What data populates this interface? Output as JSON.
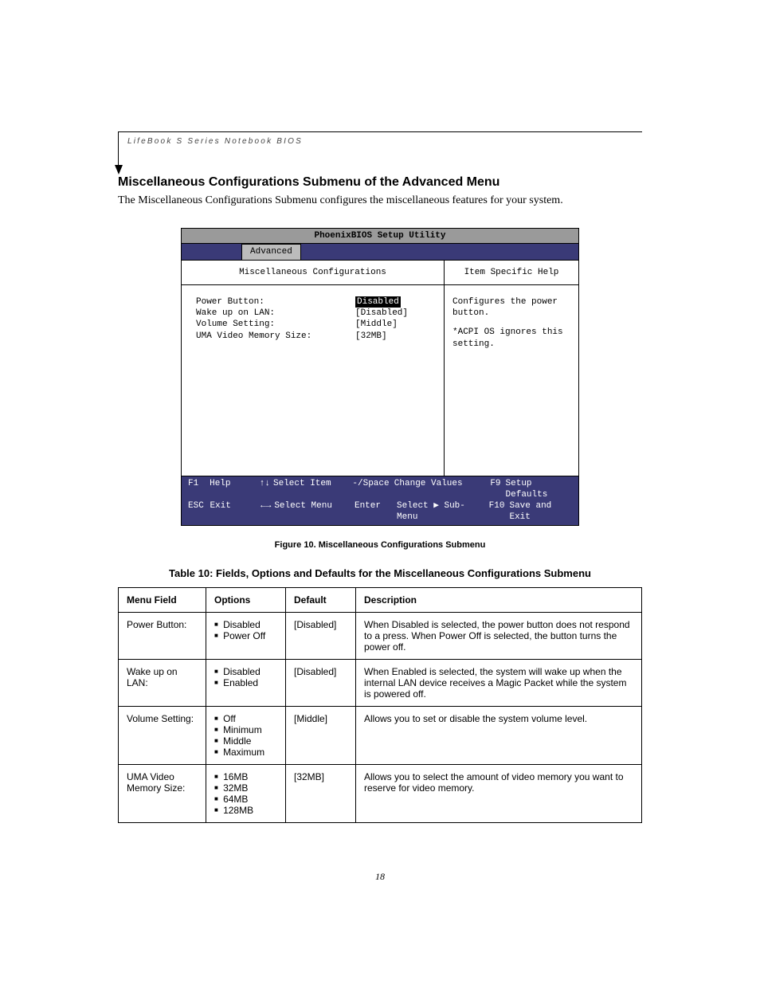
{
  "header": {
    "running_head": "LifeBook S Series Notebook BIOS"
  },
  "section": {
    "title": "Miscellaneous Configurations Submenu of the Advanced Menu",
    "intro": "The Miscellaneous Configurations Submenu configures the miscellaneous features for your system."
  },
  "bios": {
    "utility_title": "PhoenixBIOS Setup Utility",
    "active_tab": "Advanced",
    "submenu_title": "Miscellaneous Configurations",
    "help_title": "Item Specific Help",
    "fields": [
      {
        "label": "Power Button:",
        "value": "Disabled",
        "selected": true
      },
      {
        "label": "Wake up on LAN:",
        "value": "[Disabled]",
        "selected": false
      },
      {
        "label": "Volume Setting:",
        "value": "[Middle]",
        "selected": false
      },
      {
        "label": "UMA Video Memory Size:",
        "value": "[32MB]",
        "selected": false
      }
    ],
    "help_text_1": "Configures the power button.",
    "help_text_2": "*ACPI OS ignores this setting.",
    "footer": {
      "row1": {
        "k1": "F1",
        "l1": "Help",
        "a1": "↑↓",
        "l2": "Select Item",
        "k2": "-/Space",
        "l3": "Change Values",
        "k3": "F9",
        "l4": "Setup Defaults"
      },
      "row2": {
        "k1": "ESC",
        "l1": "Exit",
        "a1": "←→",
        "l2": "Select Menu",
        "k2": "Enter",
        "l3": "Select ▶ Sub-Menu",
        "k3": "F10",
        "l4": "Save and Exit"
      }
    }
  },
  "figure_caption": "Figure 10.   Miscellaneous Configurations Submenu",
  "table_caption": "Table 10: Fields, Options and Defaults for the Miscellaneous Configurations Submenu",
  "table": {
    "headers": [
      "Menu Field",
      "Options",
      "Default",
      "Description"
    ],
    "rows": [
      {
        "field": "Power Button:",
        "options": [
          "Disabled",
          "Power Off"
        ],
        "default": "[Disabled]",
        "desc": "When Disabled is selected, the power button does not respond to a press. When Power Off is selected, the button turns the power off."
      },
      {
        "field": "Wake up on LAN:",
        "options": [
          "Disabled",
          "Enabled"
        ],
        "default": "[Disabled]",
        "desc": "When Enabled is selected, the system will wake up when the internal LAN device receives a Magic Packet while the system is powered off."
      },
      {
        "field": "Volume Setting:",
        "options": [
          "Off",
          "Minimum",
          "Middle",
          "Maximum"
        ],
        "default": "[Middle]",
        "desc": "Allows you to set or disable the system volume level."
      },
      {
        "field": "UMA Video Memory Size:",
        "options": [
          "16MB",
          "32MB",
          "64MB",
          "128MB"
        ],
        "default": "[32MB]",
        "desc": "Allows you to select the amount of video memory you want to reserve for video memory."
      }
    ]
  },
  "page_number": "18"
}
